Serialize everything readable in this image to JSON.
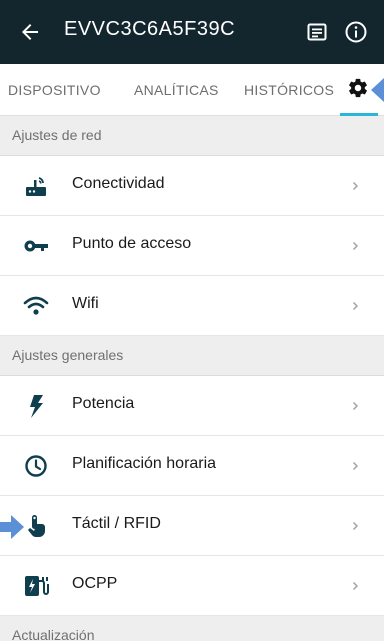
{
  "appbar": {
    "title": "EVVC3C6A5F39C",
    "back_icon": "arrow-back-icon",
    "doc_icon": "document-icon",
    "info_icon": "info-icon",
    "background": "#13262e"
  },
  "tabs": {
    "items": [
      {
        "label": "DISPOSITIVO"
      },
      {
        "label": "ANALÍTICAS"
      },
      {
        "label": "HISTÓRICOS"
      }
    ],
    "settings_icon": "gear-icon",
    "active": "settings",
    "accent": "#2ab6d8"
  },
  "sections": {
    "red": "Ajustes de red",
    "generales": "Ajustes generales",
    "actualizacion": "Actualización"
  },
  "items": {
    "conectividad": {
      "label": "Conectividad",
      "icon": "router-icon"
    },
    "punto_acceso": {
      "label": "Punto de acceso",
      "icon": "key-icon"
    },
    "wifi": {
      "label": "Wifi",
      "icon": "wifi-icon"
    },
    "potencia": {
      "label": "Potencia",
      "icon": "lightning-icon"
    },
    "planificacion": {
      "label": "Planificación horaria",
      "icon": "clock-icon"
    },
    "tactil": {
      "label": "Táctil / RFID",
      "icon": "touch-icon"
    },
    "ocpp": {
      "label": "OCPP",
      "icon": "ocpp-icon"
    }
  },
  "colors": {
    "icon": "#0f3f4f",
    "callout_arrow": "#5b8fd6"
  }
}
